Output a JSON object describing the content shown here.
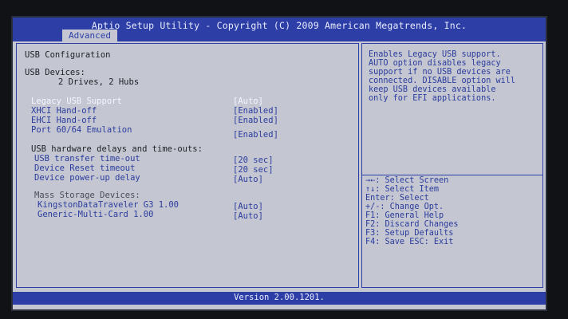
{
  "header": {
    "title": "Aptio Setup Utility - Copyright (C) 2009 American Megatrends, Inc.",
    "active_tab": "Advanced"
  },
  "main": {
    "section_title": "USB Configuration",
    "usb_devices_label": "USB Devices:",
    "usb_devices_value": "2 Drives, 2 Hubs",
    "settings": [
      {
        "label": "Legacy USB Support",
        "value": "[Auto]"
      },
      {
        "label": "XHCI Hand-off",
        "value": "[Enabled]"
      },
      {
        "label": "EHCI Hand-off",
        "value": "[Enabled]"
      },
      {
        "label": "Port 60/64 Emulation",
        "value": "[Enabled]"
      }
    ],
    "delays_heading": "USB hardware delays and time-outs:",
    "delays": [
      {
        "label": "USB transfer time-out",
        "value": "[20 sec]"
      },
      {
        "label": "Device Reset timeout",
        "value": "[20 sec]"
      },
      {
        "label": "Device power-up delay",
        "value": "[Auto]"
      }
    ],
    "mass_storage_heading": "Mass Storage Devices:",
    "mass_storage": [
      {
        "label": "KingstonDataTraveler G3 1.00",
        "value": "[Auto]"
      },
      {
        "label": "Generic-Multi-Card 1.00",
        "value": "[Auto]"
      }
    ]
  },
  "help": {
    "text": "Enables Legacy USB support.\nAUTO option disables legacy\nsupport if no USB devices are\nconnected. DISABLE option will\nkeep USB devices available\nonly for EFI applications.",
    "keys": [
      "→←: Select Screen",
      "↑↓: Select Item",
      "Enter: Select",
      "+/-: Change Opt.",
      "F1: General Help",
      "F2: Discard Changes",
      "F3: Setup Defaults",
      "F4: Save  ESC: Exit"
    ]
  },
  "footer": {
    "version": "Version 2.00.1201."
  },
  "colors": {
    "bar_blue": "#2d3fa6",
    "background": "#c4c6d2",
    "text_blue": "#2b3c9c",
    "highlight_white": "#f4f6ff"
  }
}
